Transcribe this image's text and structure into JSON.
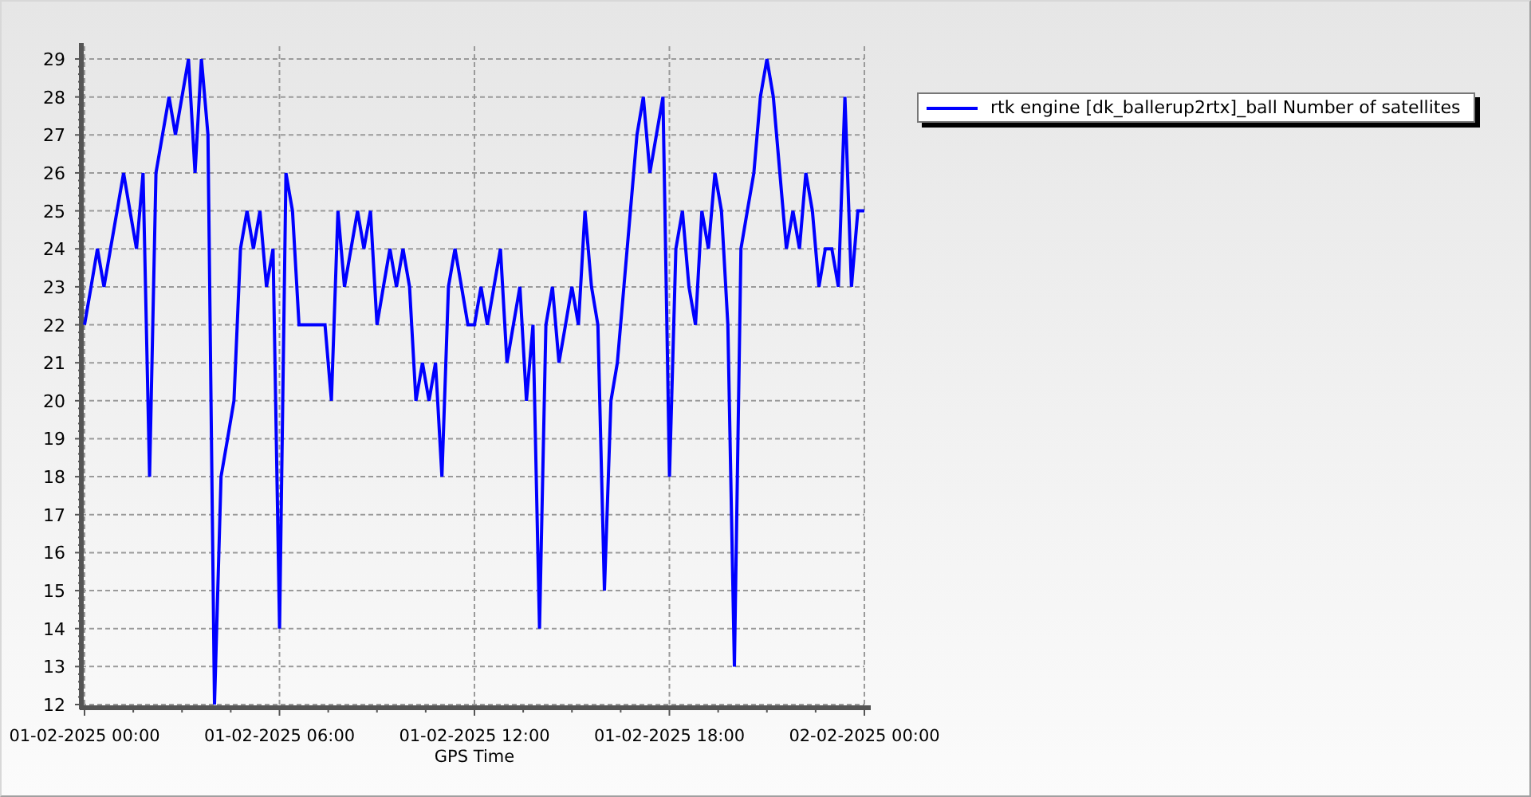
{
  "chart": {
    "chart_data": {
      "type": "line",
      "grid": true,
      "xlabel": "GPS Time",
      "categories": [
        "01-02-2025 00:00",
        null,
        null,
        null,
        null,
        null,
        null,
        null,
        null,
        null,
        null,
        null,
        null,
        null,
        null,
        null,
        null,
        null,
        null,
        null,
        null,
        null,
        null,
        null,
        null,
        null,
        null,
        null,
        null,
        null,
        "01-02-2025 06:00",
        null,
        null,
        null,
        null,
        null,
        null,
        null,
        null,
        null,
        null,
        null,
        null,
        null,
        null,
        null,
        null,
        null,
        null,
        null,
        null,
        null,
        null,
        null,
        null,
        null,
        null,
        null,
        null,
        null,
        "01-02-2025 12:00",
        null,
        null,
        null,
        null,
        null,
        null,
        null,
        null,
        null,
        null,
        null,
        null,
        null,
        null,
        null,
        null,
        null,
        null,
        null,
        null,
        null,
        null,
        null,
        null,
        null,
        null,
        null,
        null,
        null,
        "01-02-2025 18:00",
        null,
        null,
        null,
        null,
        null,
        null,
        null,
        null,
        null,
        null,
        null,
        null,
        null,
        null,
        null,
        null,
        null,
        null,
        null,
        null,
        null,
        null,
        null,
        null,
        null,
        null,
        null,
        null,
        null,
        "02-02-2025 00:00"
      ],
      "series": [
        {
          "name": "rtk engine [dk_ballerup2rtx]_ball Number of satellites",
          "color": "#0000ff",
          "values": [
            22,
            23,
            24,
            23,
            24,
            25,
            26,
            25,
            24,
            26,
            18,
            26,
            27,
            28,
            27,
            28,
            29,
            26,
            29,
            27,
            12,
            18,
            19,
            20,
            24,
            25,
            24,
            25,
            23,
            24,
            14,
            26,
            25,
            22,
            22,
            22,
            22,
            22,
            20,
            25,
            23,
            24,
            25,
            24,
            25,
            22,
            23,
            24,
            23,
            24,
            23,
            20,
            21,
            20,
            21,
            18,
            23,
            24,
            23,
            22,
            22,
            23,
            22,
            23,
            24,
            21,
            22,
            23,
            20,
            22,
            14,
            22,
            23,
            21,
            22,
            23,
            22,
            25,
            23,
            22,
            15,
            20,
            21,
            23,
            25,
            27,
            28,
            26,
            27,
            28,
            18,
            24,
            25,
            23,
            22,
            25,
            24,
            26,
            25,
            22,
            13,
            24,
            25,
            26,
            28,
            29,
            28,
            26,
            24,
            25,
            24,
            26,
            25,
            23,
            24,
            24,
            23,
            28,
            23,
            25,
            25
          ]
        }
      ],
      "ylim": [
        12,
        29
      ],
      "yticks": [
        12,
        13,
        14,
        15,
        16,
        17,
        18,
        19,
        20,
        21,
        22,
        23,
        24,
        25,
        26,
        27,
        28,
        29
      ]
    }
  }
}
